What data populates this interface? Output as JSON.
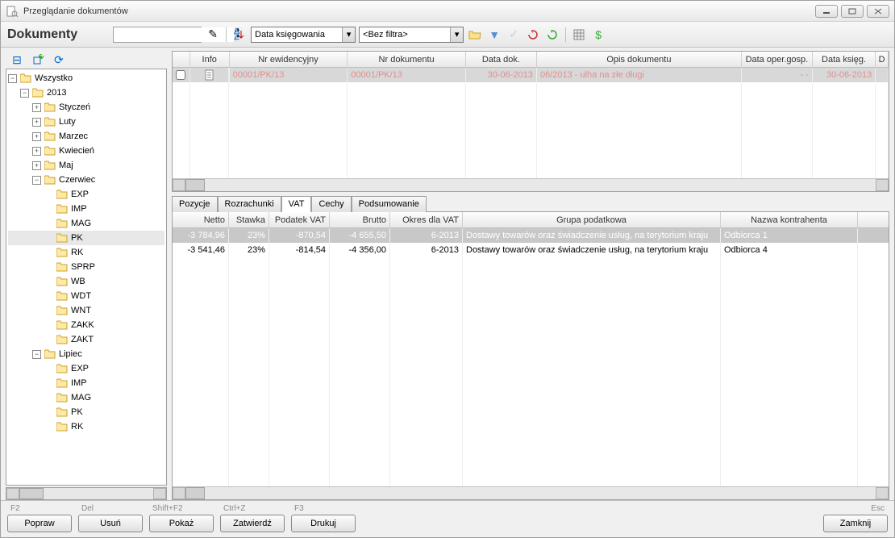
{
  "window": {
    "title": "Przeglądanie dokumentów"
  },
  "app_title": "Dokumenty",
  "toolbar": {
    "spinner_value": "",
    "combo1": "Data księgowania",
    "combo2": "<Bez filtra>"
  },
  "tree": {
    "root": "Wszystko",
    "year": "2013",
    "months_collapsed": [
      "Styczeń",
      "Luty",
      "Marzec",
      "Kwiecień",
      "Maj"
    ],
    "month_open1": "Czerwiec",
    "month_open1_children": [
      "EXP",
      "IMP",
      "MAG",
      "PK",
      "RK",
      "SPRP",
      "WB",
      "WDT",
      "WNT",
      "ZAKK",
      "ZAKT"
    ],
    "selected_child": "PK",
    "month_open2": "Lipiec",
    "month_open2_children": [
      "EXP",
      "IMP",
      "MAG",
      "PK",
      "RK"
    ]
  },
  "upper_grid": {
    "columns": [
      "",
      "Info",
      "Nr ewidencyjny",
      "Nr dokumentu",
      "Data dok.",
      "Opis dokumentu",
      "Data oper.gosp.",
      "Data księg.",
      "D"
    ],
    "row": {
      "nr_ewid": "00001/PK/13",
      "nr_dok": "00001/PK/13",
      "data_dok": "30-06-2013",
      "opis": "06/2013 - ulha na złe długi",
      "data_oper": "- -",
      "data_ksieg": "30-06-2013"
    }
  },
  "tabs": [
    "Pozycje",
    "Rozrachunki",
    "VAT",
    "Cechy",
    "Podsumowanie"
  ],
  "active_tab": "VAT",
  "lower_grid": {
    "columns": [
      "Netto",
      "Stawka",
      "Podatek VAT",
      "Brutto",
      "Okres dla VAT",
      "Grupa podatkowa",
      "Nazwa kontrahenta"
    ],
    "rows": [
      {
        "netto": "-3 784,96",
        "stawka": "23%",
        "podatek": "-870,54",
        "brutto": "-4 655,50",
        "okres": "6-2013",
        "grupa": "Dostawy towarów oraz świadczenie usług, na terytorium kraju",
        "nazwa": "Odbiorca 1"
      },
      {
        "netto": "-3 541,46",
        "stawka": "23%",
        "podatek": "-814,54",
        "brutto": "-4 356,00",
        "okres": "6-2013",
        "grupa": "Dostawy towarów oraz świadczenie usług, na terytorium kraju",
        "nazwa": "Odbiorca 4"
      }
    ]
  },
  "footer": {
    "buttons": [
      {
        "hint": "F2",
        "label": "Popraw"
      },
      {
        "hint": "Del",
        "label": "Usuń"
      },
      {
        "hint": "Shift+F2",
        "label": "Pokaż"
      },
      {
        "hint": "Ctrl+Z",
        "label": "Zatwierdź"
      },
      {
        "hint": "F3",
        "label": "Drukuj"
      }
    ],
    "close": {
      "hint": "Esc",
      "label": "Zamknij"
    }
  }
}
